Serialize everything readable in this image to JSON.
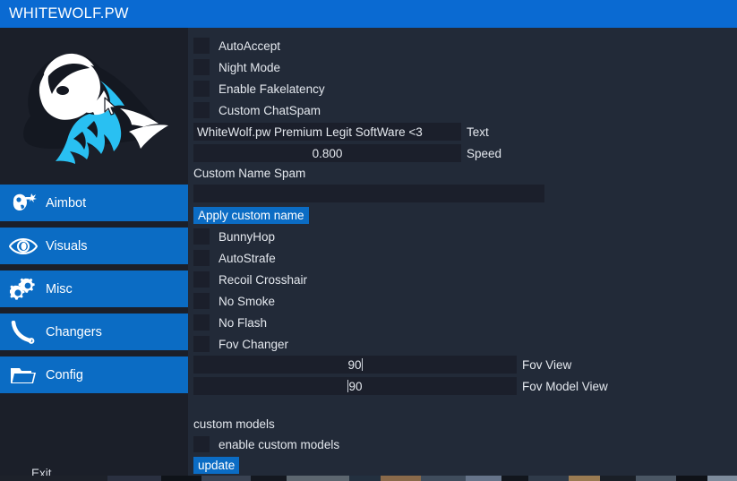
{
  "window": {
    "title": "WHITEWOLF.PW"
  },
  "colors": {
    "titlebar_blue": "#0a6ad2",
    "accent_blue": "#0b6cc4",
    "sidebar_bg": "#1b1f29",
    "panel_bg": "#222a38",
    "field_bg": "#1b1f2b",
    "text": "#e4e8ee",
    "logo_white": "#ffffff",
    "logo_cyan": "#29c0f2"
  },
  "sidebar": {
    "logo_name": "whitewolf-logo",
    "items": [
      {
        "label": "Aimbot",
        "icon": "aimbot-icon"
      },
      {
        "label": "Visuals",
        "icon": "eye-icon"
      },
      {
        "label": "Misc",
        "icon": "gears-icon"
      },
      {
        "label": "Changers",
        "icon": "hook-icon"
      },
      {
        "label": "Config",
        "icon": "folder-icon"
      }
    ],
    "exit_label": "Exit"
  },
  "main": {
    "checkboxes_top": [
      {
        "label": "AutoAccept",
        "checked": false
      },
      {
        "label": "Night Mode",
        "checked": false
      },
      {
        "label": "Enable Fakelatency",
        "checked": false
      },
      {
        "label": "Custom ChatSpam",
        "checked": false
      }
    ],
    "text_field": {
      "value": "WhiteWolf.pw Premium Legit SoftWare <3",
      "label": "Text"
    },
    "speed_field": {
      "value": "0.800",
      "label": "Speed"
    },
    "custom_name_spam": {
      "title": "Custom Name Spam",
      "value": "",
      "button_label": "Apply custom name"
    },
    "checkboxes_mid": [
      {
        "label": "BunnyHop",
        "checked": false
      },
      {
        "label": "AutoStrafe",
        "checked": false
      },
      {
        "label": "Recoil Crosshair",
        "checked": false
      },
      {
        "label": "No Smoke",
        "checked": false
      },
      {
        "label": "No Flash",
        "checked": false
      },
      {
        "label": "Fov Changer",
        "checked": false
      }
    ],
    "fov_view": {
      "value": "90",
      "label": "Fov View"
    },
    "fov_model_view": {
      "value": "90",
      "label": "Fov Model View"
    },
    "custom_models": {
      "title": "custom models",
      "checkbox_label": "enable custom models",
      "checkbox_checked": false,
      "button_label": "update"
    }
  }
}
